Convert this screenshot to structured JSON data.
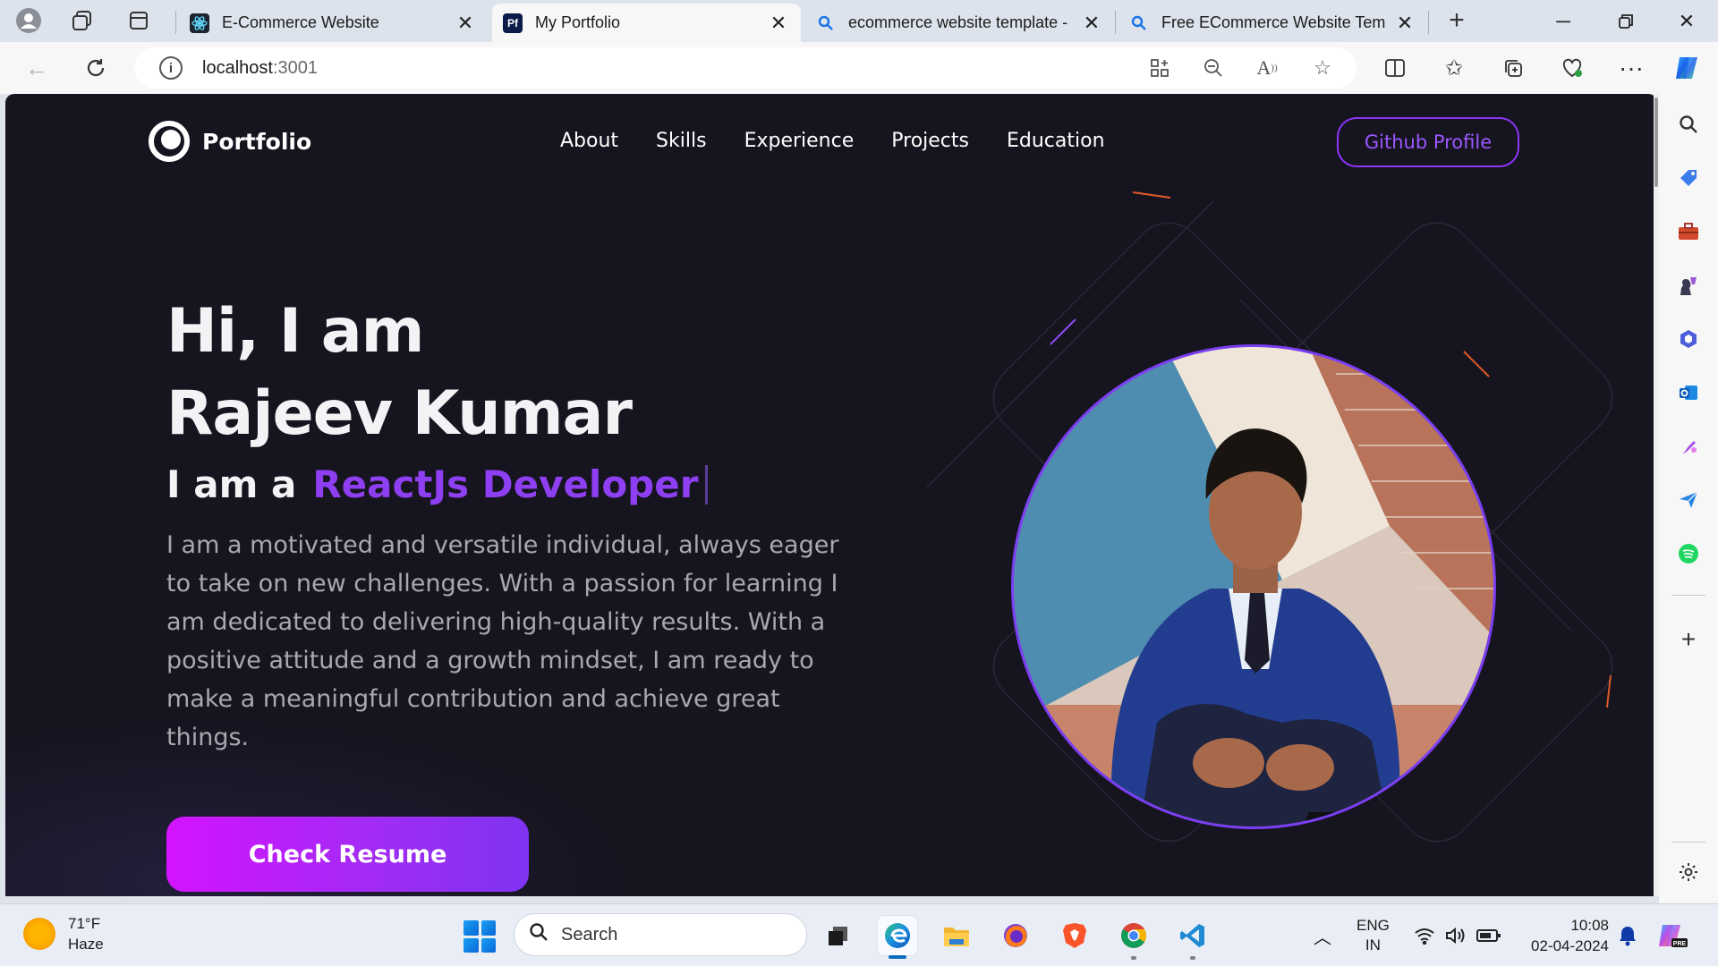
{
  "browser": {
    "tabs": [
      {
        "title": "E-Commerce Website",
        "icon": "react-icon",
        "active": false
      },
      {
        "title": "My Portfolio",
        "icon": "portfolio-favicon",
        "active": true
      },
      {
        "title": "ecommerce website template -",
        "icon": "search-icon",
        "active": false
      },
      {
        "title": "Free ECommerce Website Temp",
        "icon": "search-icon",
        "active": false
      }
    ],
    "url_host": "localhost",
    "url_port": ":3001"
  },
  "site": {
    "logo_text": "Portfolio",
    "nav": [
      "About",
      "Skills",
      "Experience",
      "Projects",
      "Education"
    ],
    "github_button": "Github Profile",
    "greeting_line1": "Hi, I am",
    "greeting_line2": "Rajeev Kumar",
    "role_prefix": "I am a",
    "role_highlight": "ReactJs Developer",
    "description": "I am a motivated and versatile individual, always eager to take on new challenges. With a passion for learning I am dedicated to delivering high-quality results. With a positive attitude and a growth mindset, I am ready to make a meaningful contribution and achieve great things.",
    "resume_button": "Check Resume",
    "accent_color": "#8e3ff1"
  },
  "taskbar": {
    "weather_temp": "71°F",
    "weather_desc": "Haze",
    "search_placeholder": "Search",
    "lang_line1": "ENG",
    "lang_line2": "IN",
    "time": "10:08",
    "date": "02-04-2024"
  }
}
